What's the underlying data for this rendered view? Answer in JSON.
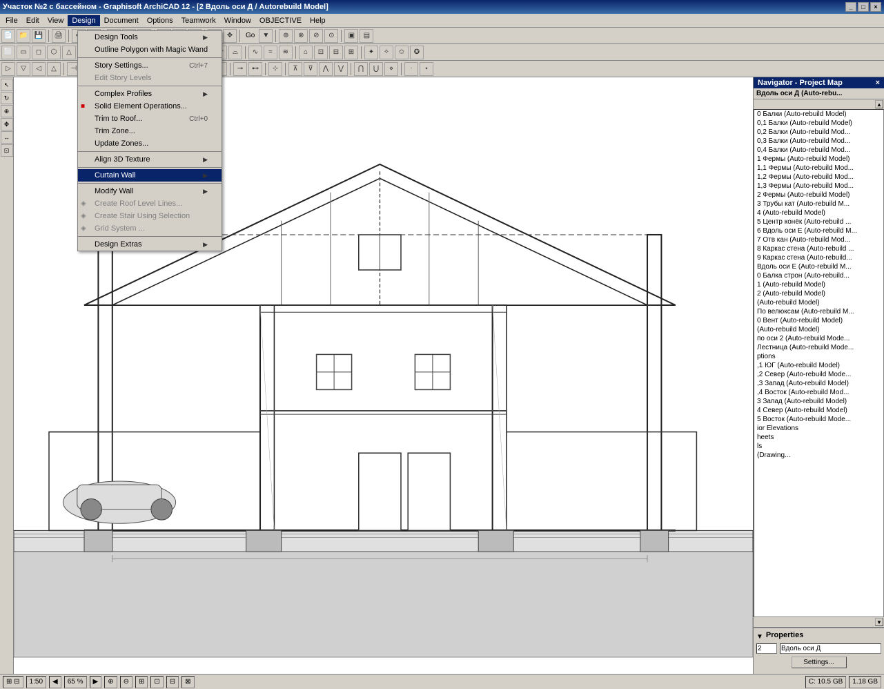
{
  "titlebar": {
    "title": "Участок №2 с бассейном - Graphisoft ArchiCAD 12 - [2 Вдоль оси Д / Autorebuild Model]",
    "buttons": [
      "_",
      "□",
      "×"
    ]
  },
  "menubar": {
    "items": [
      {
        "label": "File",
        "active": false
      },
      {
        "label": "Edit",
        "active": false
      },
      {
        "label": "View",
        "active": false
      },
      {
        "label": "Design",
        "active": true
      },
      {
        "label": "Document",
        "active": false
      },
      {
        "label": "Options",
        "active": false
      },
      {
        "label": "Teamwork",
        "active": false
      },
      {
        "label": "Window",
        "active": false
      },
      {
        "label": "OBJECTIVE",
        "active": false
      },
      {
        "label": "Help",
        "active": false
      }
    ]
  },
  "design_menu": {
    "items": [
      {
        "id": "design_tools",
        "label": "Design Tools",
        "shortcut": "",
        "arrow": "▶",
        "disabled": false,
        "icon": ""
      },
      {
        "id": "outline_polygon",
        "label": "Outline Polygon with Magic Wand",
        "shortcut": "",
        "arrow": "",
        "disabled": false,
        "icon": ""
      },
      {
        "id": "sep1",
        "type": "separator"
      },
      {
        "id": "story_settings",
        "label": "Story Settings...",
        "shortcut": "Ctrl+7",
        "arrow": "",
        "disabled": false,
        "icon": ""
      },
      {
        "id": "edit_story_levels",
        "label": "Edit Story Levels",
        "shortcut": "",
        "arrow": "",
        "disabled": true,
        "icon": ""
      },
      {
        "id": "sep2",
        "type": "separator"
      },
      {
        "id": "complex_profiles",
        "label": "Complex Profiles",
        "shortcut": "",
        "arrow": "▶",
        "disabled": false,
        "icon": ""
      },
      {
        "id": "solid_element_ops",
        "label": "Solid Element Operations...",
        "shortcut": "",
        "arrow": "",
        "disabled": false,
        "icon": "solid"
      },
      {
        "id": "trim_to_roof",
        "label": "Trim to Roof...",
        "shortcut": "Ctrl+0",
        "arrow": "",
        "disabled": false,
        "icon": ""
      },
      {
        "id": "trim_zone",
        "label": "Trim Zone...",
        "shortcut": "",
        "arrow": "",
        "disabled": false,
        "icon": ""
      },
      {
        "id": "update_zones",
        "label": "Update Zones...",
        "shortcut": "",
        "arrow": "",
        "disabled": false,
        "icon": ""
      },
      {
        "id": "sep3",
        "type": "separator"
      },
      {
        "id": "align_3d_texture",
        "label": "Align 3D Texture",
        "shortcut": "",
        "arrow": "▶",
        "disabled": false,
        "icon": ""
      },
      {
        "id": "sep4",
        "type": "separator"
      },
      {
        "id": "curtain_wall",
        "label": "Curtain Wall",
        "shortcut": "",
        "arrow": "▶",
        "disabled": false,
        "icon": ""
      },
      {
        "id": "sep5",
        "type": "separator"
      },
      {
        "id": "modify_wall",
        "label": "Modify Wall",
        "shortcut": "",
        "arrow": "▶",
        "disabled": false,
        "icon": ""
      },
      {
        "id": "create_roof_level",
        "label": "Create Roof Level Lines...",
        "shortcut": "",
        "arrow": "",
        "disabled": true,
        "icon": ""
      },
      {
        "id": "create_stair",
        "label": "Create Stair Using Selection",
        "shortcut": "",
        "arrow": "",
        "disabled": true,
        "icon": ""
      },
      {
        "id": "grid_system",
        "label": "Grid System ...",
        "shortcut": "",
        "arrow": "",
        "disabled": true,
        "icon": ""
      },
      {
        "id": "sep6",
        "type": "separator"
      },
      {
        "id": "design_extras",
        "label": "Design Extras",
        "shortcut": "",
        "arrow": "▶",
        "disabled": false,
        "icon": ""
      }
    ]
  },
  "navigator": {
    "title": "Navigator - Project Map",
    "header_item": "Вдоль оси Д (Auto-rebu...",
    "items": [
      "0 Балки (Auto-rebuild Model)",
      "0,1 Балки (Auto-rebuild Model)",
      "0,2 Балки (Auto-rebuild Mod...",
      "0,3 Балки (Auto-rebuild Mod...",
      "0,4 Балки (Auto-rebuild Mod...",
      "1 Фермы (Auto-rebuild Model)",
      "1,1 Фермы (Auto-rebuild Mod...",
      "1,2 Фермы (Auto-rebuild Mod...",
      "1,3 Фермы (Auto-rebuild Mod...",
      "2 Фермы (Auto-rebuild Model)",
      "3 Трубы кат (Auto-rebuild M...",
      "4 (Auto-rebuild Model)",
      "5 Центр конёк (Auto-rebuild ...",
      "6 Вдоль оси Е (Auto-rebuild M...",
      "7 Отв кан (Auto-rebuild Mod...",
      "8 Каркас стена (Auto-rebuild ...",
      "9 Каркас стена (Auto-rebuild...",
      "Вдоль оси Е (Auto-rebuild M...",
      "0 Балка строн (Auto-rebuild...",
      "1 (Auto-rebuild Model)",
      "2 (Auto-rebuild Model)",
      "(Auto-rebuild Model)",
      "По велюксам (Auto-rebuild M...",
      "0 Вент (Auto-rebuild Model)",
      "(Auto-rebuild Model)",
      "по оси 2 (Auto-rebuild Mode...",
      "Лестница (Auto-rebuild Mode...",
      "ptions",
      ",1 ЮГ (Auto-rebuild Model)",
      ",2 Север (Auto-rebuild Mode...",
      ",3 Запад (Auto-rebuild Model)",
      ",4 Восток (Auto-rebuild Mod...",
      "3 Запад (Auto-rebuild Model)",
      "4 Север (Auto-rebuild Model)",
      "5 Восток (Auto-rebuild Mode...",
      "ior Elevations",
      "heets",
      "ls",
      "(Drawing..."
    ]
  },
  "properties": {
    "title": "Properties",
    "label1": "2",
    "label2": "Вдоль оси Д",
    "settings_btn": "Settings..."
  },
  "statusbar": {
    "left": "⊞",
    "scale": "1:50",
    "zoom": "65 %",
    "nav_buttons": "◀ ▶",
    "disk_c": "C: 10.5 GB",
    "disk_d": "1.18 GB"
  }
}
